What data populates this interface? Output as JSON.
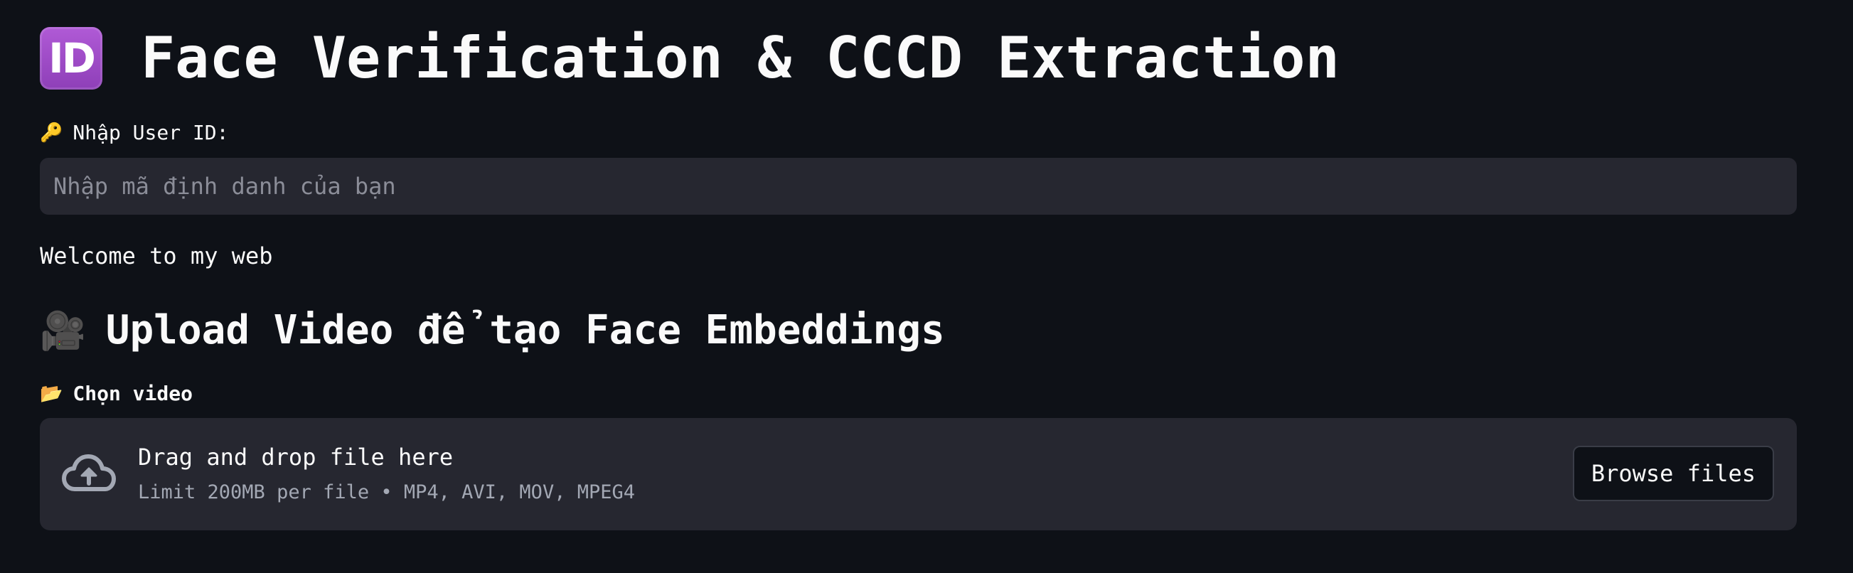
{
  "header": {
    "badge_text": "ID",
    "title": "Face Verification & CCCD Extraction",
    "badge_color": "#9b4dca"
  },
  "user_id": {
    "icon": "key-icon",
    "icon_glyph": "🔑",
    "label": "Nhập User ID:",
    "placeholder": "Nhập mã định danh của bạn",
    "value": ""
  },
  "welcome_text": "Welcome to my web",
  "upload_section": {
    "icon": "video-camera-icon",
    "icon_glyph": "🎥",
    "title": "Upload Video để tạo Face Embeddings",
    "file_label_icon": "folder-icon",
    "file_label_glyph": "📂",
    "file_label": "Chọn video",
    "dropzone": {
      "icon": "cloud-upload-icon",
      "main_text": "Drag and drop file here",
      "limit_text": "Limit 200MB per file • MP4, AVI, MOV, MPEG4",
      "browse_label": "Browse files"
    }
  },
  "colors": {
    "background": "#0e1117",
    "input_bg": "#262730",
    "text": "#fafafa",
    "muted_text": "#a3a8b4"
  }
}
